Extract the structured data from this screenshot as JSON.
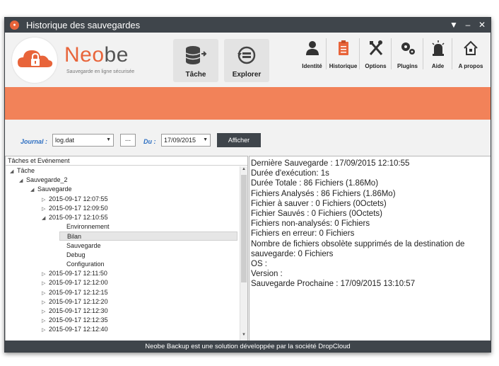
{
  "window": {
    "title": "Historique des sauvegardes"
  },
  "logo": {
    "brand_prefix": "Neo",
    "brand_suffix": "be",
    "tagline": "Sauvegarde en ligne sécurisée"
  },
  "toolbar": {
    "tache_label": "Tâche",
    "explorer_label": "Explorer",
    "items": [
      {
        "label": "Identité",
        "icon": "user-icon"
      },
      {
        "label": "Historique",
        "icon": "clipboard-icon"
      },
      {
        "label": "Options",
        "icon": "tools-icon"
      },
      {
        "label": "Plugins",
        "icon": "gears-icon"
      },
      {
        "label": "Aide",
        "icon": "siren-icon"
      },
      {
        "label": "A propos",
        "icon": "home-icon"
      }
    ]
  },
  "filters": {
    "journal_label": "Journal :",
    "journal_value": "log.dat",
    "browse_label": "...",
    "du_label": "Du :",
    "date_value": "17/09/2015",
    "afficher_label": "Afficher"
  },
  "tree": {
    "header": "Tâches et Evénement",
    "rows": [
      {
        "twisty": "◢",
        "text": "Tâche"
      },
      {
        "twisty": "◢",
        "text": "Sauvegarde_2"
      },
      {
        "twisty": "◢",
        "text": "Sauvegarde"
      },
      {
        "twisty": "▷",
        "text": "2015-09-17  12:07:55"
      },
      {
        "twisty": "▷",
        "text": "2015-09-17  12:09:50"
      },
      {
        "twisty": "◢",
        "text": "2015-09-17  12:10:55"
      },
      {
        "twisty": "",
        "text": "Environnement"
      },
      {
        "twisty": "",
        "text": "Bilan"
      },
      {
        "twisty": "",
        "text": "Sauvegarde"
      },
      {
        "twisty": "",
        "text": "Debug"
      },
      {
        "twisty": "",
        "text": "Configuration"
      },
      {
        "twisty": "▷",
        "text": "2015-09-17  12:11:50"
      },
      {
        "twisty": "▷",
        "text": "2015-09-17  12:12:00"
      },
      {
        "twisty": "▷",
        "text": "2015-09-17  12:12:15"
      },
      {
        "twisty": "▷",
        "text": "2015-09-17  12:12:20"
      },
      {
        "twisty": "▷",
        "text": "2015-09-17  12:12:30"
      },
      {
        "twisty": "▷",
        "text": "2015-09-17  12:12:35"
      },
      {
        "twisty": "▷",
        "text": "2015-09-17  12:12:40"
      }
    ]
  },
  "details": [
    "Dernière Sauvegarde : 17/09/2015 12:10:55",
    "Durée d'exécution: 1s",
    "Durée Totale : 86 Fichiers (1.86Mo)",
    "Fichiers Analysés : 86 Fichiers (1.86Mo)",
    "Fichier à sauver : 0 Fichiers (0Octets)",
    "Fichier Sauvés : 0 Fichiers (0Octets)",
    "Fichiers non-analysés:  0 Fichiers",
    "Fichiers en erreur:  0 Fichiers",
    "Nombre de fichiers obsolète supprimés de la destination de sauvegarde:  0 Fichiers",
    "OS :",
    "Version :",
    "Sauvegarde Prochaine : 17/09/2015 13:10:57"
  ],
  "statusbar": {
    "text": "Neobe Backup est une solution développée par la société DropCloud"
  },
  "colors": {
    "accent": "#f28259",
    "brand": "#e8643a",
    "dark": "#3f454b",
    "link": "#2d6fc2"
  }
}
